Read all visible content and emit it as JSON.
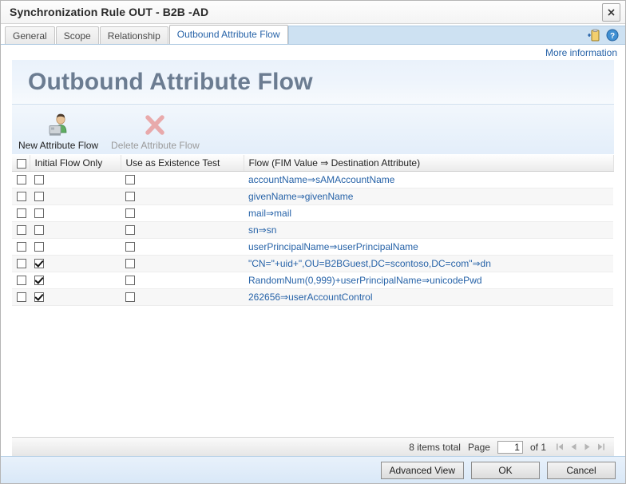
{
  "window": {
    "title": "Synchronization Rule OUT - B2B -AD",
    "close_label": "✖"
  },
  "tabs": [
    {
      "label": "General",
      "active": false
    },
    {
      "label": "Scope",
      "active": false
    },
    {
      "label": "Relationship",
      "active": false
    },
    {
      "label": "Outbound Attribute Flow",
      "active": true
    }
  ],
  "tab_tools": [
    {
      "name": "add-clipboard-icon",
      "label": "clipboard-add-icon"
    },
    {
      "name": "help-icon",
      "label": "help-icon"
    }
  ],
  "more_information": "More information",
  "banner": {
    "title": "Outbound Attribute Flow"
  },
  "toolbar": {
    "new_label": "New Attribute Flow",
    "delete_label": "Delete Attribute Flow",
    "new_icon": "new-user-flow-icon",
    "delete_icon": "red-x-delete-icon"
  },
  "grid": {
    "columns": [
      {
        "key": "select",
        "label": ""
      },
      {
        "key": "initial_flow_only",
        "label": "Initial Flow Only"
      },
      {
        "key": "use_as_existence_test",
        "label": "Use as Existence Test"
      },
      {
        "key": "flow",
        "label": "Flow (FIM Value ⇒ Destination Attribute)"
      }
    ],
    "header_select_checked": false,
    "rows": [
      {
        "select": false,
        "initial_flow_only": false,
        "use_as_existence_test": false,
        "flow": "accountName⇒sAMAccountName"
      },
      {
        "select": false,
        "initial_flow_only": false,
        "use_as_existence_test": false,
        "flow": "givenName⇒givenName"
      },
      {
        "select": false,
        "initial_flow_only": false,
        "use_as_existence_test": false,
        "flow": "mail⇒mail"
      },
      {
        "select": false,
        "initial_flow_only": false,
        "use_as_existence_test": false,
        "flow": "sn⇒sn"
      },
      {
        "select": false,
        "initial_flow_only": false,
        "use_as_existence_test": false,
        "flow": "userPrincipalName⇒userPrincipalName"
      },
      {
        "select": false,
        "initial_flow_only": true,
        "use_as_existence_test": false,
        "flow": "\"CN=\"+uid+\",OU=B2BGuest,DC=scontoso,DC=com\"⇒dn"
      },
      {
        "select": false,
        "initial_flow_only": true,
        "use_as_existence_test": false,
        "flow": "RandomNum(0,999)+userPrincipalName⇒unicodePwd"
      },
      {
        "select": false,
        "initial_flow_only": true,
        "use_as_existence_test": false,
        "flow": "262656⇒userAccountControl"
      }
    ]
  },
  "pager": {
    "items_total": "8 items total",
    "page_label": "Page",
    "page_value": "1",
    "of_label": "of 1",
    "first_icon": "first-page-icon",
    "prev_icon": "previous-page-icon",
    "next_icon": "next-page-icon",
    "last_icon": "last-page-icon"
  },
  "footer": {
    "advanced_view": "Advanced View",
    "ok": "OK",
    "cancel": "Cancel"
  },
  "colors": {
    "link": "#2763a8",
    "banner_title": "#6b7c91",
    "tab_active_text": "#2763a8",
    "tab_filler": "#cde1f2"
  }
}
